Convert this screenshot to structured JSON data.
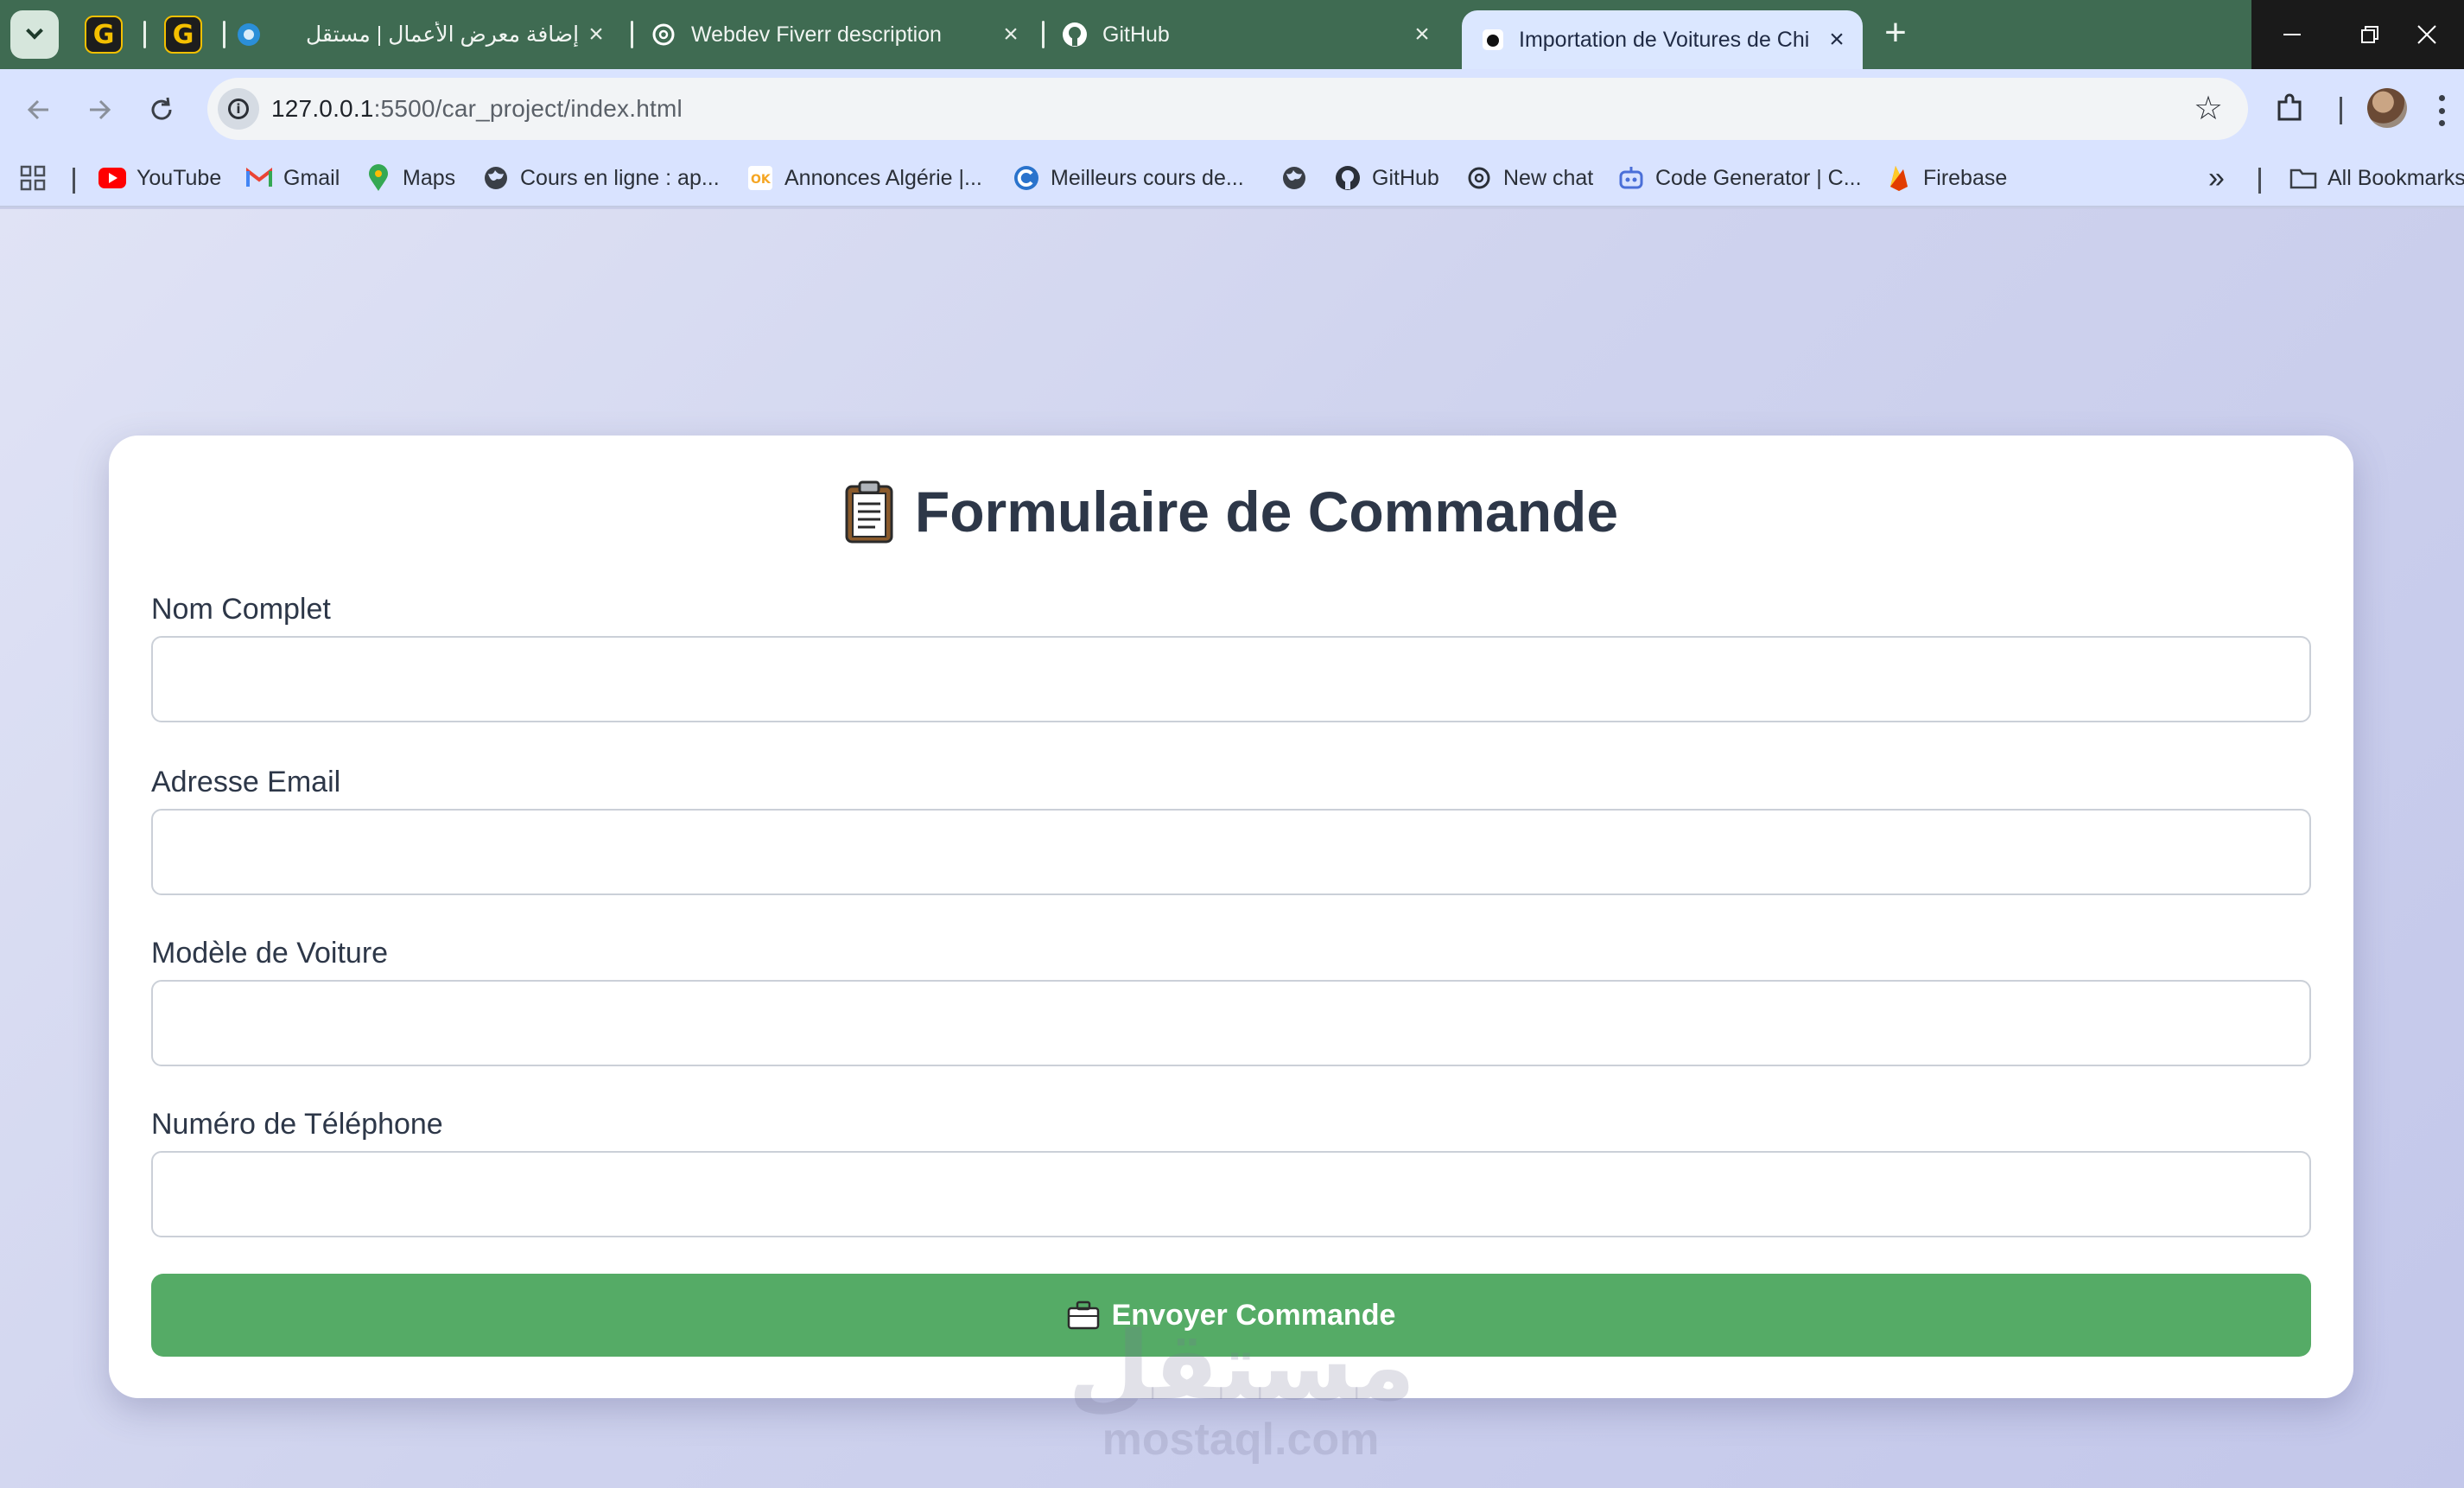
{
  "browser": {
    "tabs": [
      {
        "id": "pinned-1",
        "title": "",
        "icon": "grammarly-icon"
      },
      {
        "id": "pinned-2",
        "title": "",
        "icon": "grammarly-icon"
      },
      {
        "id": "tab-mostaql",
        "title": "إضافة معرض الأعمال | مستقل",
        "icon": "mostaql-icon"
      },
      {
        "id": "tab-webdev",
        "title": "Webdev Fiverr description",
        "icon": "openai-icon"
      },
      {
        "id": "tab-github",
        "title": "GitHub",
        "icon": "github-icon"
      },
      {
        "id": "tab-active",
        "title": "Importation de Voitures de Chi",
        "icon": "page-icon"
      }
    ],
    "new_tab_label": "+",
    "url_host": "127.0.0.1",
    "url_path": ":5500/car_project/index.html",
    "bookmarks": [
      {
        "label": "YouTube",
        "icon": "youtube-icon"
      },
      {
        "label": "Gmail",
        "icon": "gmail-icon"
      },
      {
        "label": "Maps",
        "icon": "maps-icon"
      },
      {
        "label": "Cours en ligne  : ap...",
        "icon": "globe-icon"
      },
      {
        "label": "Annonces Algérie |...",
        "icon": "ok-icon"
      },
      {
        "label": "Meilleurs cours de...",
        "icon": "coursera-icon"
      },
      {
        "label": "",
        "icon": "globe-icon"
      },
      {
        "label": "GitHub",
        "icon": "github-icon"
      },
      {
        "label": "New chat",
        "icon": "openai-icon"
      },
      {
        "label": "Code Generator | C...",
        "icon": "robot-icon"
      },
      {
        "label": "Firebase",
        "icon": "firebase-icon"
      }
    ],
    "overflow_label": "»",
    "all_bookmarks_label": "All Bookmarks"
  },
  "form": {
    "title": "Formulaire de Commande",
    "title_icon": "clipboard-icon",
    "fields": [
      {
        "label": "Nom Complet",
        "value": "",
        "placeholder": ""
      },
      {
        "label": "Adresse Email",
        "value": "",
        "placeholder": ""
      },
      {
        "label": "Modèle de Voiture",
        "value": "",
        "placeholder": ""
      },
      {
        "label": "Numéro de Téléphone",
        "value": "",
        "placeholder": ""
      }
    ],
    "submit_label": "Envoyer Commande",
    "submit_icon": "briefcase-icon",
    "submit_color": "#55ab66"
  },
  "watermark": {
    "arabic": "مستقل",
    "latin": "mostaql.com"
  }
}
